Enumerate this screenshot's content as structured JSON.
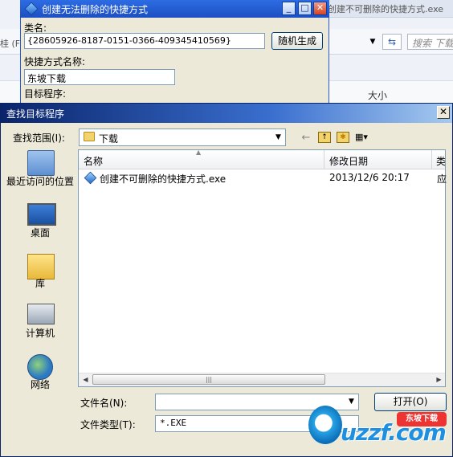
{
  "background_window": {
    "title": "创建不可删除的快捷方式.exe",
    "left_text": "桂 (F:",
    "search_placeholder": "搜索 下载",
    "column_size": "大小"
  },
  "small_dialog": {
    "title": "创建无法删除的快捷方式",
    "classname_label": "类名:",
    "classname_value": "{28605926-8187-0151-0366-409345410569}",
    "random_button": "随机生成",
    "shortcut_label": "快捷方式名称:",
    "shortcut_value": "东坡下载",
    "target_label": "目标程序:"
  },
  "open_dialog": {
    "title": "查找目标程序",
    "lookin_label": "查找范围(I):",
    "lookin_value": "下载",
    "places": [
      {
        "label": "最近访问的位置"
      },
      {
        "label": "桌面"
      },
      {
        "label": "库"
      },
      {
        "label": "计算机"
      },
      {
        "label": "网络"
      }
    ],
    "columns": {
      "name": "名称",
      "date": "修改日期",
      "type": "类"
    },
    "files": [
      {
        "name": "创建不可删除的快捷方式.exe",
        "date": "2013/12/6 20:17",
        "type": "应"
      }
    ],
    "filename_label": "文件名(N):",
    "filename_value": "",
    "open_button": "打开(O)",
    "filetype_label": "文件类型(T):",
    "filetype_value": "*.EXE"
  },
  "watermark": {
    "badge": "东坡下载",
    "text": "uzzf.com"
  }
}
